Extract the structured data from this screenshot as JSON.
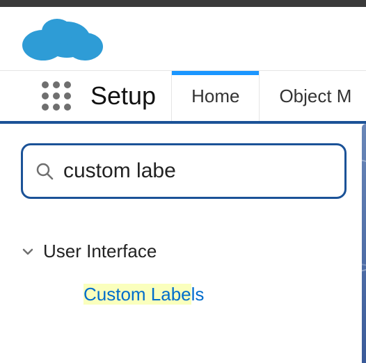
{
  "brand": {
    "color": "#2e9cd6"
  },
  "nav": {
    "title": "Setup",
    "tabs": [
      {
        "label": "Home",
        "active": true
      },
      {
        "label": "Object M",
        "active": false
      }
    ]
  },
  "search": {
    "value": "custom labe",
    "placeholder": ""
  },
  "tree": {
    "section_label": "User Interface",
    "item_label": "Custom Labels",
    "item_highlight_prefix": "Custom Labe",
    "item_highlight_suffix": "ls"
  }
}
